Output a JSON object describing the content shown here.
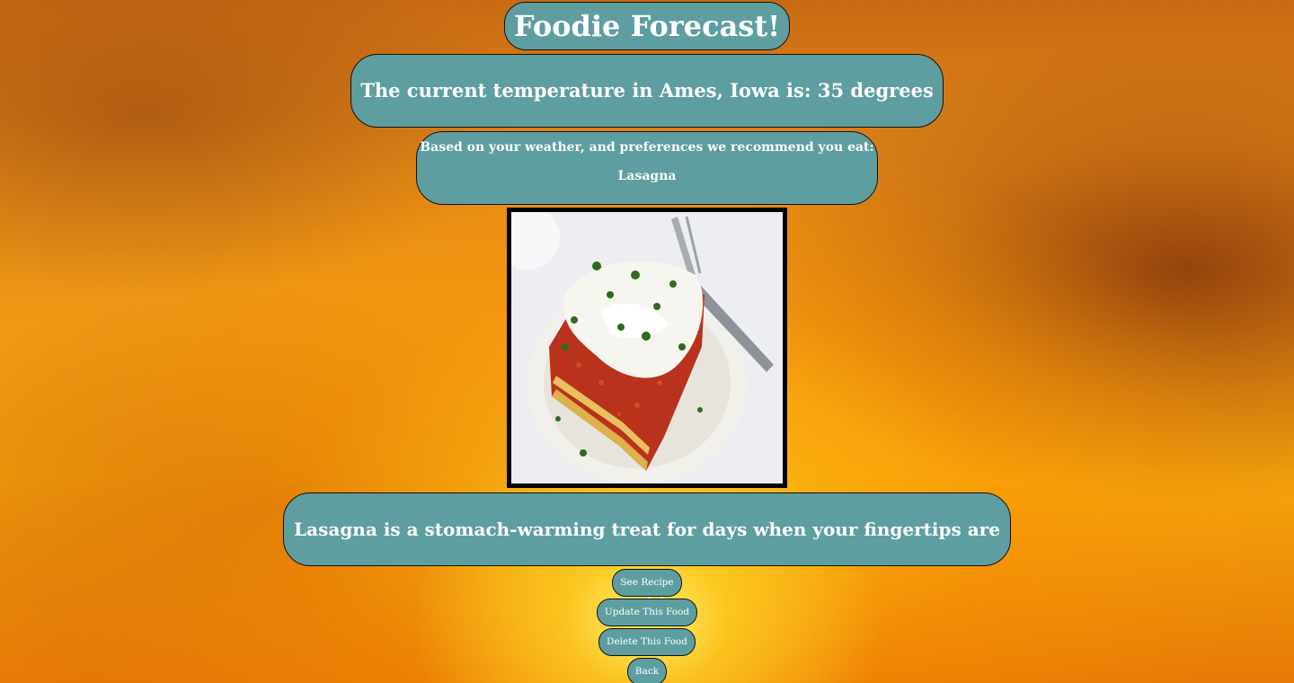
{
  "header": {
    "title": "Foodie Forecast!"
  },
  "weather": {
    "temperature_text": "The current temperature in Ames, Iowa is: 35 degrees"
  },
  "recommendation": {
    "intro": "Based on your weather, and preferences we recommend you eat:",
    "food_name": "Lasagna"
  },
  "food_image": {
    "icon": "lasagna-photo"
  },
  "description": {
    "text": "Lasagna is a stomach-warming treat for days when your fingertips are cold."
  },
  "actions": {
    "see_recipe": "See Recipe",
    "update_food": "Update This Food",
    "delete_food": "Delete This Food",
    "back": "Back"
  },
  "colors": {
    "pill_background": "#5f9ea0",
    "pill_border": "#111111",
    "text": "#ffffff",
    "sky_accent": "#f5a30c"
  }
}
